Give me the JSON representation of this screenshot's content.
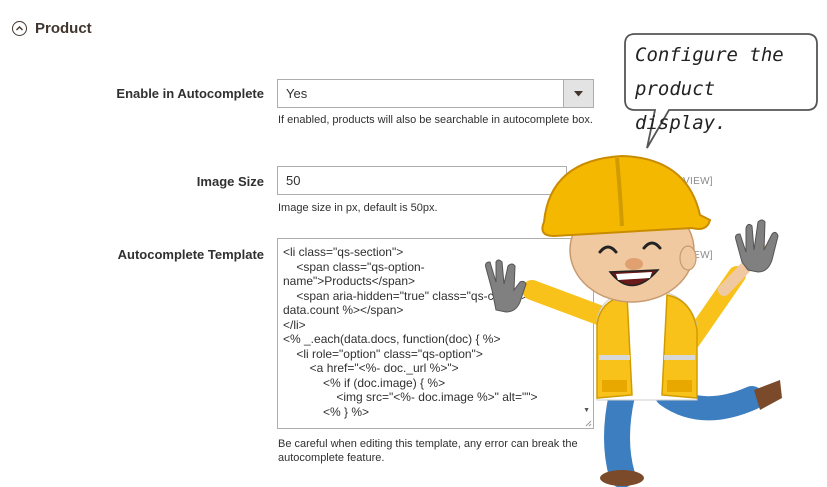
{
  "section": {
    "title": "Product"
  },
  "fields": {
    "autocomplete": {
      "label": "Enable in Autocomplete",
      "value": "Yes",
      "note": "If enabled, products will also be searchable in autocomplete box."
    },
    "image_size": {
      "label": "Image Size",
      "value": "50",
      "note": "Image size in px, default is 50px.",
      "scope": "E VIEW]"
    },
    "template": {
      "label": "Autocomplete Template",
      "scope": "E VIEW]",
      "note": "Be careful when editing this template, any error can break the autocomplete feature."
    }
  },
  "callout": {
    "text": "Configure the product display."
  },
  "colors": {
    "border": "#adadad",
    "helmet": "#f5b800",
    "vest": "#f8c21a",
    "pants": "#3d7ec0"
  }
}
